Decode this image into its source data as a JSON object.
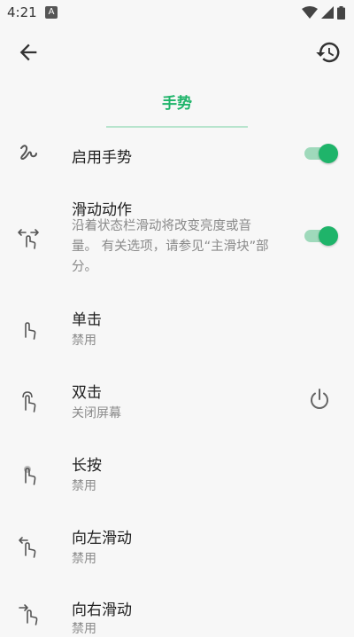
{
  "status": {
    "time": "4:21",
    "notif_letter": "A"
  },
  "header": {
    "back_icon": "back-arrow-icon",
    "restore_icon": "restore-icon"
  },
  "tab": {
    "label": "手势"
  },
  "colors": {
    "accent": "#1fb46a",
    "background": "#f7f7f7"
  },
  "settings": [
    {
      "title": "启用手势",
      "icon": "gesture-squiggle-icon",
      "toggle_on": true
    },
    {
      "title": "滑动动作",
      "description": "沿着状态栏滑动将改变亮度或音量。 有关选项，请参见“主滑块”部分。",
      "icon": "swipe-horizontal-icon",
      "toggle_on": true
    },
    {
      "title": "单击",
      "subtitle": "禁用",
      "icon": "tap-icon"
    },
    {
      "title": "双击",
      "subtitle": "关闭屏幕",
      "icon": "double-tap-icon",
      "action_icon": "power-icon"
    },
    {
      "title": "长按",
      "subtitle": "禁用",
      "icon": "long-press-icon"
    },
    {
      "title": "向左滑动",
      "subtitle": "禁用",
      "icon": "swipe-left-icon"
    },
    {
      "title": "向右滑动",
      "subtitle": "禁用",
      "icon": "swipe-right-icon"
    }
  ]
}
